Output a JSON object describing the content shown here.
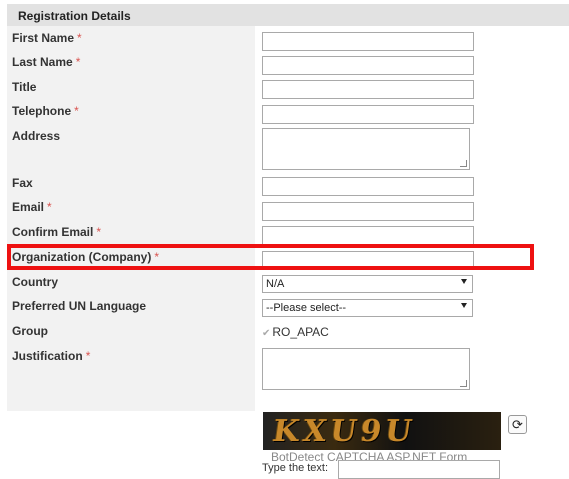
{
  "section": {
    "title": "Registration Details"
  },
  "required_marker": "*",
  "fields": {
    "first_name": {
      "label": "First Name",
      "required": true,
      "value": ""
    },
    "last_name": {
      "label": "Last Name",
      "required": true,
      "value": ""
    },
    "title": {
      "label": "Title",
      "required": false,
      "value": ""
    },
    "telephone": {
      "label": "Telephone",
      "required": true,
      "value": ""
    },
    "address": {
      "label": "Address",
      "required": false,
      "value": ""
    },
    "fax": {
      "label": "Fax",
      "required": false,
      "value": ""
    },
    "email": {
      "label": "Email",
      "required": true,
      "value": ""
    },
    "confirm_email": {
      "label": "Confirm Email",
      "required": true,
      "value": ""
    },
    "organization": {
      "label": "Organization (Company)",
      "required": true,
      "value": ""
    },
    "country": {
      "label": "Country",
      "selected": "N/A"
    },
    "language": {
      "label": "Preferred UN Language",
      "selected": "--Please select--"
    },
    "group": {
      "label": "Group",
      "option": "RO_APAC",
      "checked": true
    },
    "justification": {
      "label": "Justification",
      "required": true,
      "value": ""
    }
  },
  "captcha": {
    "image_text": "KXU9U",
    "caption": "BotDetect CAPTCHA ASP.NET Form",
    "type_label": "Type the text:",
    "reload_icon": "reload-icon"
  },
  "highlight_color": "#ee1111"
}
